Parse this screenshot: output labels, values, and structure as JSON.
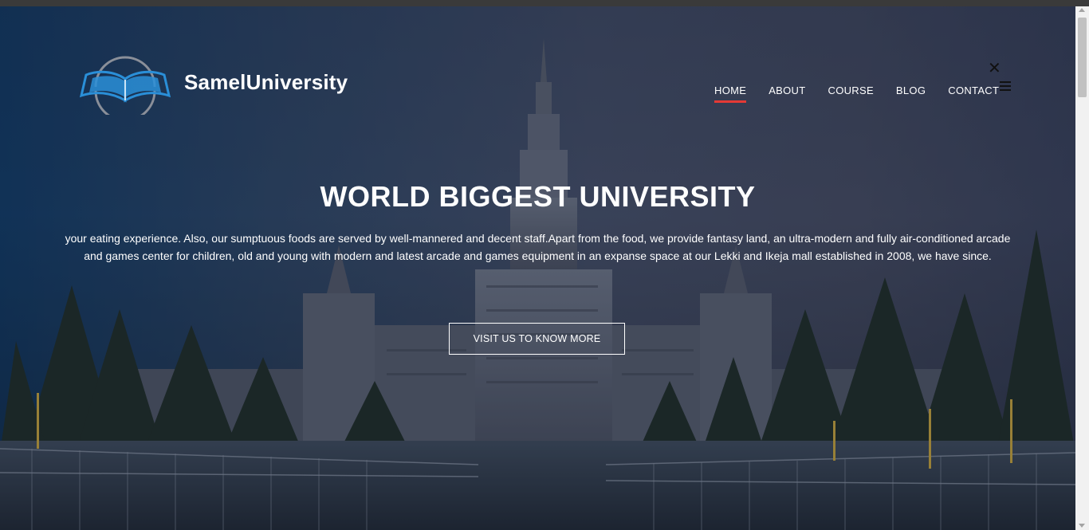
{
  "brand": {
    "name": "SamelUniversity"
  },
  "nav": {
    "items": [
      {
        "label": "HOME",
        "active": true
      },
      {
        "label": "ABOUT",
        "active": false
      },
      {
        "label": "COURSE",
        "active": false
      },
      {
        "label": "BLOG",
        "active": false
      },
      {
        "label": "CONTACT",
        "active": false
      }
    ],
    "close_icon": "close-icon",
    "menu_icon": "hamburger-menu-icon"
  },
  "hero": {
    "title": "WORLD BIGGEST UNIVERSITY",
    "description": "your eating experience. Also, our sumptuous foods are served by well-mannered and decent staff.Apart from the food, we provide fantasy land, an ultra-modern and fully air-conditioned arcade and games center for children, old and young with modern and latest arcade and games equipment in an expanse space at our Lekki and Ikeja mall established in 2008, we have since.",
    "cta_label": "VISIT US TO KNOW MORE",
    "background": "university-building-photo"
  },
  "colors": {
    "accent": "#e53935",
    "logo_blue": "#2a8fd8",
    "logo_gray": "#8a8f99",
    "text": "#ffffff"
  }
}
